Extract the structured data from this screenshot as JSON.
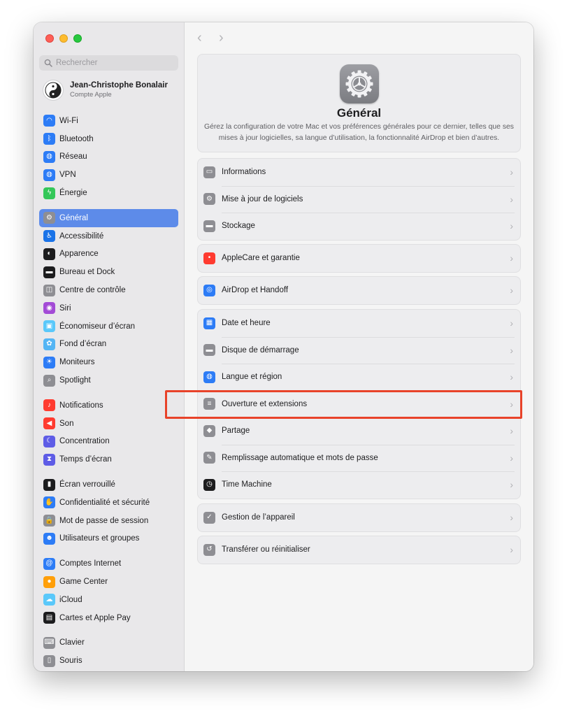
{
  "search": {
    "placeholder": "Rechercher",
    "icon": "magnifier"
  },
  "profile": {
    "name": "Jean-Christophe Bonalair",
    "subtitle": "Compte Apple"
  },
  "sidebar": {
    "groups": [
      [
        {
          "label": "Wi-Fi",
          "icon": "wifi",
          "color": "#2d7cf6"
        },
        {
          "label": "Bluetooth",
          "icon": "bluetooth",
          "color": "#2d7cf6"
        },
        {
          "label": "Réseau",
          "icon": "globe",
          "color": "#2d7cf6"
        },
        {
          "label": "VPN",
          "icon": "globe",
          "color": "#2d7cf6"
        },
        {
          "label": "Énergie",
          "icon": "bolt",
          "color": "#34c759"
        }
      ],
      [
        {
          "label": "Général",
          "icon": "gear",
          "color": "#8e8e93",
          "active": true
        },
        {
          "label": "Accessibilité",
          "icon": "accessibility",
          "color": "#1a73e8"
        },
        {
          "label": "Apparence",
          "icon": "appearance",
          "color": "#1c1c1e"
        },
        {
          "label": "Bureau et Dock",
          "icon": "dock",
          "color": "#1c1c1e"
        },
        {
          "label": "Centre de contrôle",
          "icon": "control-center",
          "color": "#8e8e93"
        },
        {
          "label": "Siri",
          "icon": "siri",
          "color": "#a34bd6"
        },
        {
          "label": "Économiseur d’écran",
          "icon": "screensaver",
          "color": "#5ac8fa"
        },
        {
          "label": "Fond d’écran",
          "icon": "flower",
          "color": "#54b5f4"
        },
        {
          "label": "Moniteurs",
          "icon": "sun",
          "color": "#2d7cf6"
        },
        {
          "label": "Spotlight",
          "icon": "magnifier",
          "color": "#8e8e93"
        }
      ],
      [
        {
          "label": "Notifications",
          "icon": "bell",
          "color": "#ff3b30"
        },
        {
          "label": "Son",
          "icon": "speaker",
          "color": "#ff3b30"
        },
        {
          "label": "Concentration",
          "icon": "moon",
          "color": "#5e5ce6"
        },
        {
          "label": "Temps d’écran",
          "icon": "hourglass",
          "color": "#5e5ce6"
        }
      ],
      [
        {
          "label": "Écran verrouillé",
          "icon": "lock-screen",
          "color": "#1c1c1e"
        },
        {
          "label": "Confidentialité et sécurité",
          "icon": "hand",
          "color": "#2d7cf6"
        },
        {
          "label": "Mot de passe de session",
          "icon": "lock",
          "color": "#8e8e93"
        },
        {
          "label": "Utilisateurs et groupes",
          "icon": "users",
          "color": "#2d7cf6"
        }
      ],
      [
        {
          "label": "Comptes Internet",
          "icon": "at",
          "color": "#2d7cf6"
        },
        {
          "label": "Game Center",
          "icon": "game-center",
          "color": "#ff9f0a"
        },
        {
          "label": "iCloud",
          "icon": "cloud",
          "color": "#5ac8fa"
        },
        {
          "label": "Cartes et Apple Pay",
          "icon": "wallet",
          "color": "#1c1c1e"
        }
      ],
      [
        {
          "label": "Clavier",
          "icon": "keyboard",
          "color": "#8e8e93"
        },
        {
          "label": "Souris",
          "icon": "mouse",
          "color": "#8e8e93"
        }
      ]
    ]
  },
  "main": {
    "hero": {
      "title": "Général",
      "description": "Gérez la configuration de votre Mac et vos préférences générales pour ce dernier, telles que ses mises à jour logicielles, sa langue d’utilisation, la fonctionnalité AirDrop et bien d’autres."
    },
    "sections": [
      [
        {
          "label": "Informations",
          "icon": "display",
          "color": "#8e8e93"
        },
        {
          "label": "Mise à jour de logiciels",
          "icon": "gear",
          "color": "#8e8e93"
        },
        {
          "label": "Stockage",
          "icon": "drive",
          "color": "#8e8e93"
        }
      ],
      [
        {
          "label": "AppleCare et garantie",
          "icon": "apple",
          "color": "#ff3b30"
        }
      ],
      [
        {
          "label": "AirDrop et Handoff",
          "icon": "airdrop",
          "color": "#2d7cf6"
        }
      ],
      [
        {
          "label": "Date et heure",
          "icon": "calendar",
          "color": "#2d7cf6"
        },
        {
          "label": "Disque de démarrage",
          "icon": "drive",
          "color": "#8e8e93"
        },
        {
          "label": "Langue et région",
          "icon": "globe",
          "color": "#2d7cf6"
        },
        {
          "label": "Ouverture et extensions",
          "icon": "list",
          "color": "#8e8e93",
          "highlighted": true
        },
        {
          "label": "Partage",
          "icon": "share",
          "color": "#8e8e93"
        },
        {
          "label": "Remplissage automatique et mots de passe",
          "icon": "pencil",
          "color": "#8e8e93"
        },
        {
          "label": "Time Machine",
          "icon": "time-machine",
          "color": "#1c1c1e"
        }
      ],
      [
        {
          "label": "Gestion de l’appareil",
          "icon": "checkmark",
          "color": "#8e8e93"
        }
      ],
      [
        {
          "label": "Transférer ou réinitialiser",
          "icon": "reset",
          "color": "#8e8e93"
        }
      ]
    ]
  },
  "nav": {
    "back": "‹",
    "forward": "›"
  },
  "chevron": "›",
  "accent": "#5d8be9",
  "highlight_color": "#e8432a"
}
